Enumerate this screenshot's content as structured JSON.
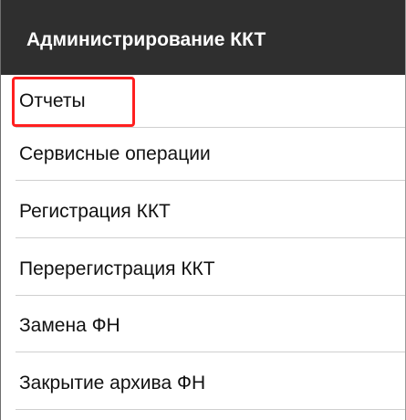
{
  "header": {
    "title": "Администрирование ККТ"
  },
  "menu": {
    "items": [
      {
        "label": "Отчеты"
      },
      {
        "label": "Сервисные операции"
      },
      {
        "label": "Регистрация ККТ"
      },
      {
        "label": "Перерегистрация ККТ"
      },
      {
        "label": "Замена ФН"
      },
      {
        "label": "Закрытие архива ФН"
      }
    ]
  },
  "highlight": {
    "color": "#ff1f1f",
    "target": "Отчеты"
  },
  "colors": {
    "app_bar": "#2f2f2f",
    "title_text": "#ffffff",
    "item_text": "#111111",
    "divider": "#cfcfcf",
    "background": "#ffffff"
  }
}
